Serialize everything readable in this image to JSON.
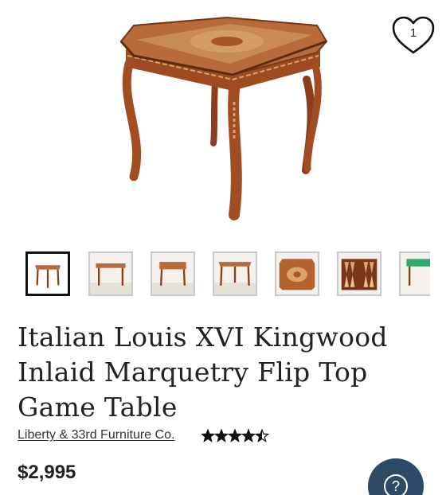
{
  "product": {
    "title": "Italian Louis XVI Kingwood Inlaid Marquetry Flip Top Game Table",
    "seller": "Liberty & 33rd Furniture Co.",
    "rating": 4.5,
    "rating_max": 5,
    "price": "$2,995"
  },
  "favorite": {
    "count": "1",
    "icon": "heart-icon"
  },
  "gallery": {
    "active_index": 0,
    "thumbnails": [
      "table-front",
      "table-side",
      "table-angle",
      "table-front-2",
      "inlay-top",
      "backgammon-board",
      "green-felt-top"
    ]
  },
  "help": {
    "glyph": "?",
    "icon": "help-icon"
  },
  "colors": {
    "wood": "#a8552a",
    "wood_dark": "#7a3517",
    "inlay": "#d9a56b",
    "help_bg": "#2f4a66"
  }
}
